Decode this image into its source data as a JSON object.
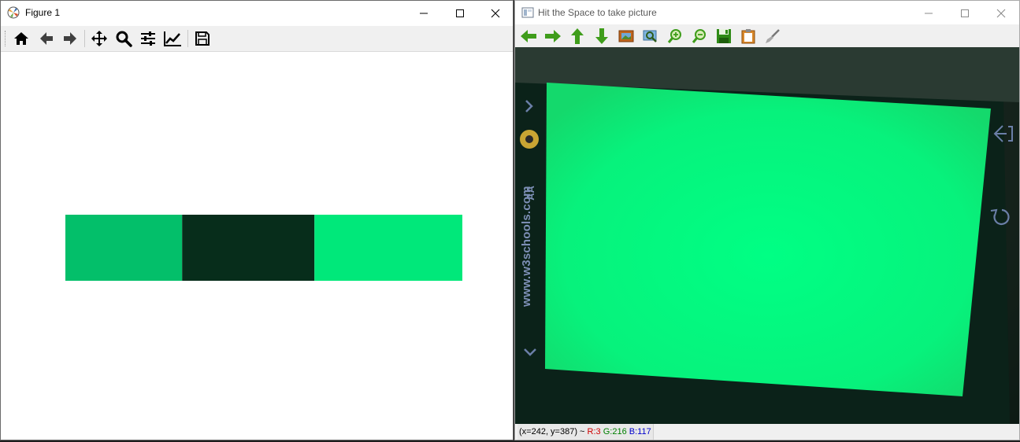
{
  "left_window": {
    "title": "Figure 1",
    "toolbar_tools": [
      "home-icon",
      "back-arrow-icon",
      "forward-arrow-icon",
      "pan-move-icon",
      "zoom-magnifier-icon",
      "configure-subplots-icon",
      "edit-axis-line-icon",
      "save-floppy-icon"
    ],
    "swatches": [
      {
        "color": "#03bf6a",
        "width": 3
      },
      {
        "color": "#072d1b",
        "width": 3.4
      },
      {
        "color": "#00e87a",
        "width": 3.8
      }
    ]
  },
  "right_window": {
    "title": "Hit the Space to take picture",
    "toolbar_tools": [
      "pan-left-icon",
      "pan-right-icon",
      "pan-up-icon",
      "pan-down-icon",
      "zoom-image-icon",
      "zoom-fit-icon",
      "zoom-in-icon",
      "zoom-out-icon",
      "save-image-icon",
      "copy-clipboard-icon",
      "properties-brush-icon"
    ],
    "camera_overlay_text": "www.w3schools.com",
    "camera_side_label": "AA",
    "screen_color": "#00ff84",
    "status": {
      "coords": "(x=242, y=387) ~",
      "r": "R:3",
      "g": "G:216",
      "b": "B:117"
    }
  }
}
